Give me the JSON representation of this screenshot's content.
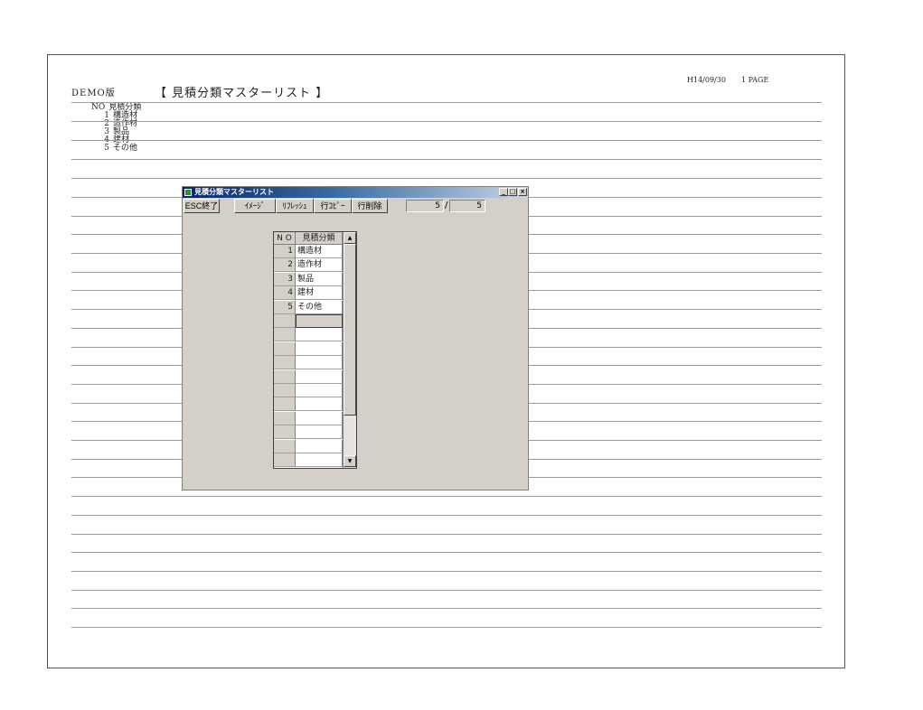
{
  "report": {
    "demo_label": "DEMO版",
    "title": "【 見積分類マスターリスト 】",
    "date": "H14/09/30",
    "page": "1 PAGE",
    "column_no": "NO",
    "column_name": "見積分類",
    "rows": [
      {
        "no": "1",
        "name": "構造材"
      },
      {
        "no": "2",
        "name": "造作材"
      },
      {
        "no": "3",
        "name": "製品"
      },
      {
        "no": "4",
        "name": "建材"
      },
      {
        "no": "5",
        "name": "その他"
      }
    ]
  },
  "window": {
    "title": "見積分類マスターリスト",
    "minimize": "_",
    "maximize": "□",
    "close": "×",
    "toolbar": {
      "esc": "ESC終了",
      "image": "ｲﾒｰｼﾞ",
      "refresh": "ﾘﾌﾚｯｼｭ",
      "row_copy": "行ｺﾋﾟｰ",
      "row_delete": "行削除"
    },
    "counter": {
      "current": "5",
      "separator": "/",
      "total": "5"
    },
    "grid": {
      "header_no": "N O",
      "header_name": "見積分類",
      "rows": [
        {
          "no": "1",
          "name": "構造材"
        },
        {
          "no": "2",
          "name": "造作材"
        },
        {
          "no": "3",
          "name": "製品"
        },
        {
          "no": "4",
          "name": "建材"
        },
        {
          "no": "5",
          "name": "その他"
        },
        {
          "no": "",
          "name": ""
        },
        {
          "no": "",
          "name": ""
        },
        {
          "no": "",
          "name": ""
        },
        {
          "no": "",
          "name": ""
        },
        {
          "no": "",
          "name": ""
        },
        {
          "no": "",
          "name": ""
        },
        {
          "no": "",
          "name": ""
        },
        {
          "no": "",
          "name": ""
        },
        {
          "no": "",
          "name": ""
        },
        {
          "no": "",
          "name": ""
        },
        {
          "no": "",
          "name": ""
        }
      ],
      "scroll_up": "▲",
      "scroll_down": "▼"
    }
  }
}
